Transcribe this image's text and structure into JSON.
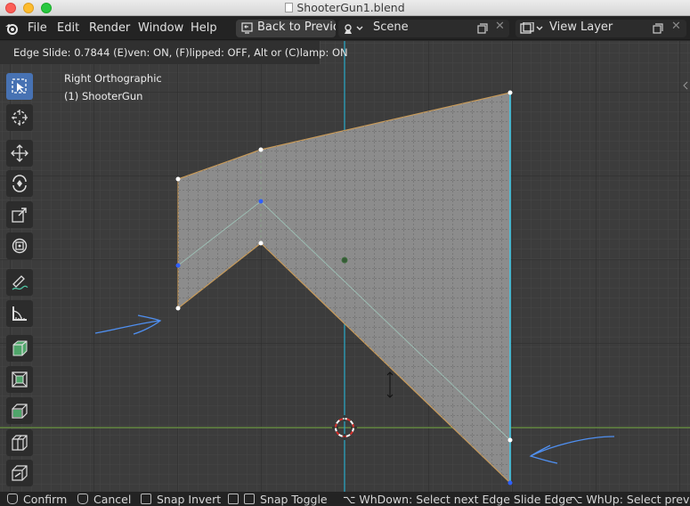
{
  "window": {
    "title": "ShooterGun1.blend"
  },
  "menu": {
    "items": [
      "File",
      "Edit",
      "Render",
      "Window",
      "Help"
    ]
  },
  "workspace": {
    "back_label": "Back to Previou",
    "scene_label": "Scene",
    "view_layer_label": "View Layer"
  },
  "viewport": {
    "operator_info": "Edge Slide: 0.7844 (E)ven: ON, (F)lipped: OFF, Alt or (C)lamp: ON",
    "view_name": "Right Orthographic",
    "object_name": "(1) ShooterGun"
  },
  "toolbar": {
    "tools": [
      "select-box",
      "cursor",
      "move",
      "rotate",
      "scale",
      "transform",
      "annotate",
      "measure",
      "add-cube",
      "extrude",
      "inset",
      "bevel",
      "loop-cut",
      "knife"
    ]
  },
  "statusbar": {
    "items": [
      {
        "key": "mouse-left-icon",
        "label": "Confirm"
      },
      {
        "key": "mouse-right-icon",
        "label": "Cancel"
      },
      {
        "key": "ctrl-icon",
        "label": "Snap Invert"
      },
      {
        "key": "shift-icon",
        "label": "Snap Toggle"
      },
      {
        "key": "option-key",
        "label": "⌥ WhDown: Select next Edge Slide Edge"
      },
      {
        "key": "option-key",
        "label": "⌥ WhUp: Select previou"
      }
    ]
  },
  "colors": {
    "viewport_bg": "#3c3c3c",
    "face_fill": "#8b8b8b",
    "edge_orange": "#c79a5a",
    "selected_edge": "#3fc7e8",
    "vertex_blue": "#2f5fff",
    "y_axis": "#7aa04a",
    "z_axis": "#2aa3bf",
    "annotation": "#4f8ff0",
    "active_tool": "#4772b3"
  }
}
